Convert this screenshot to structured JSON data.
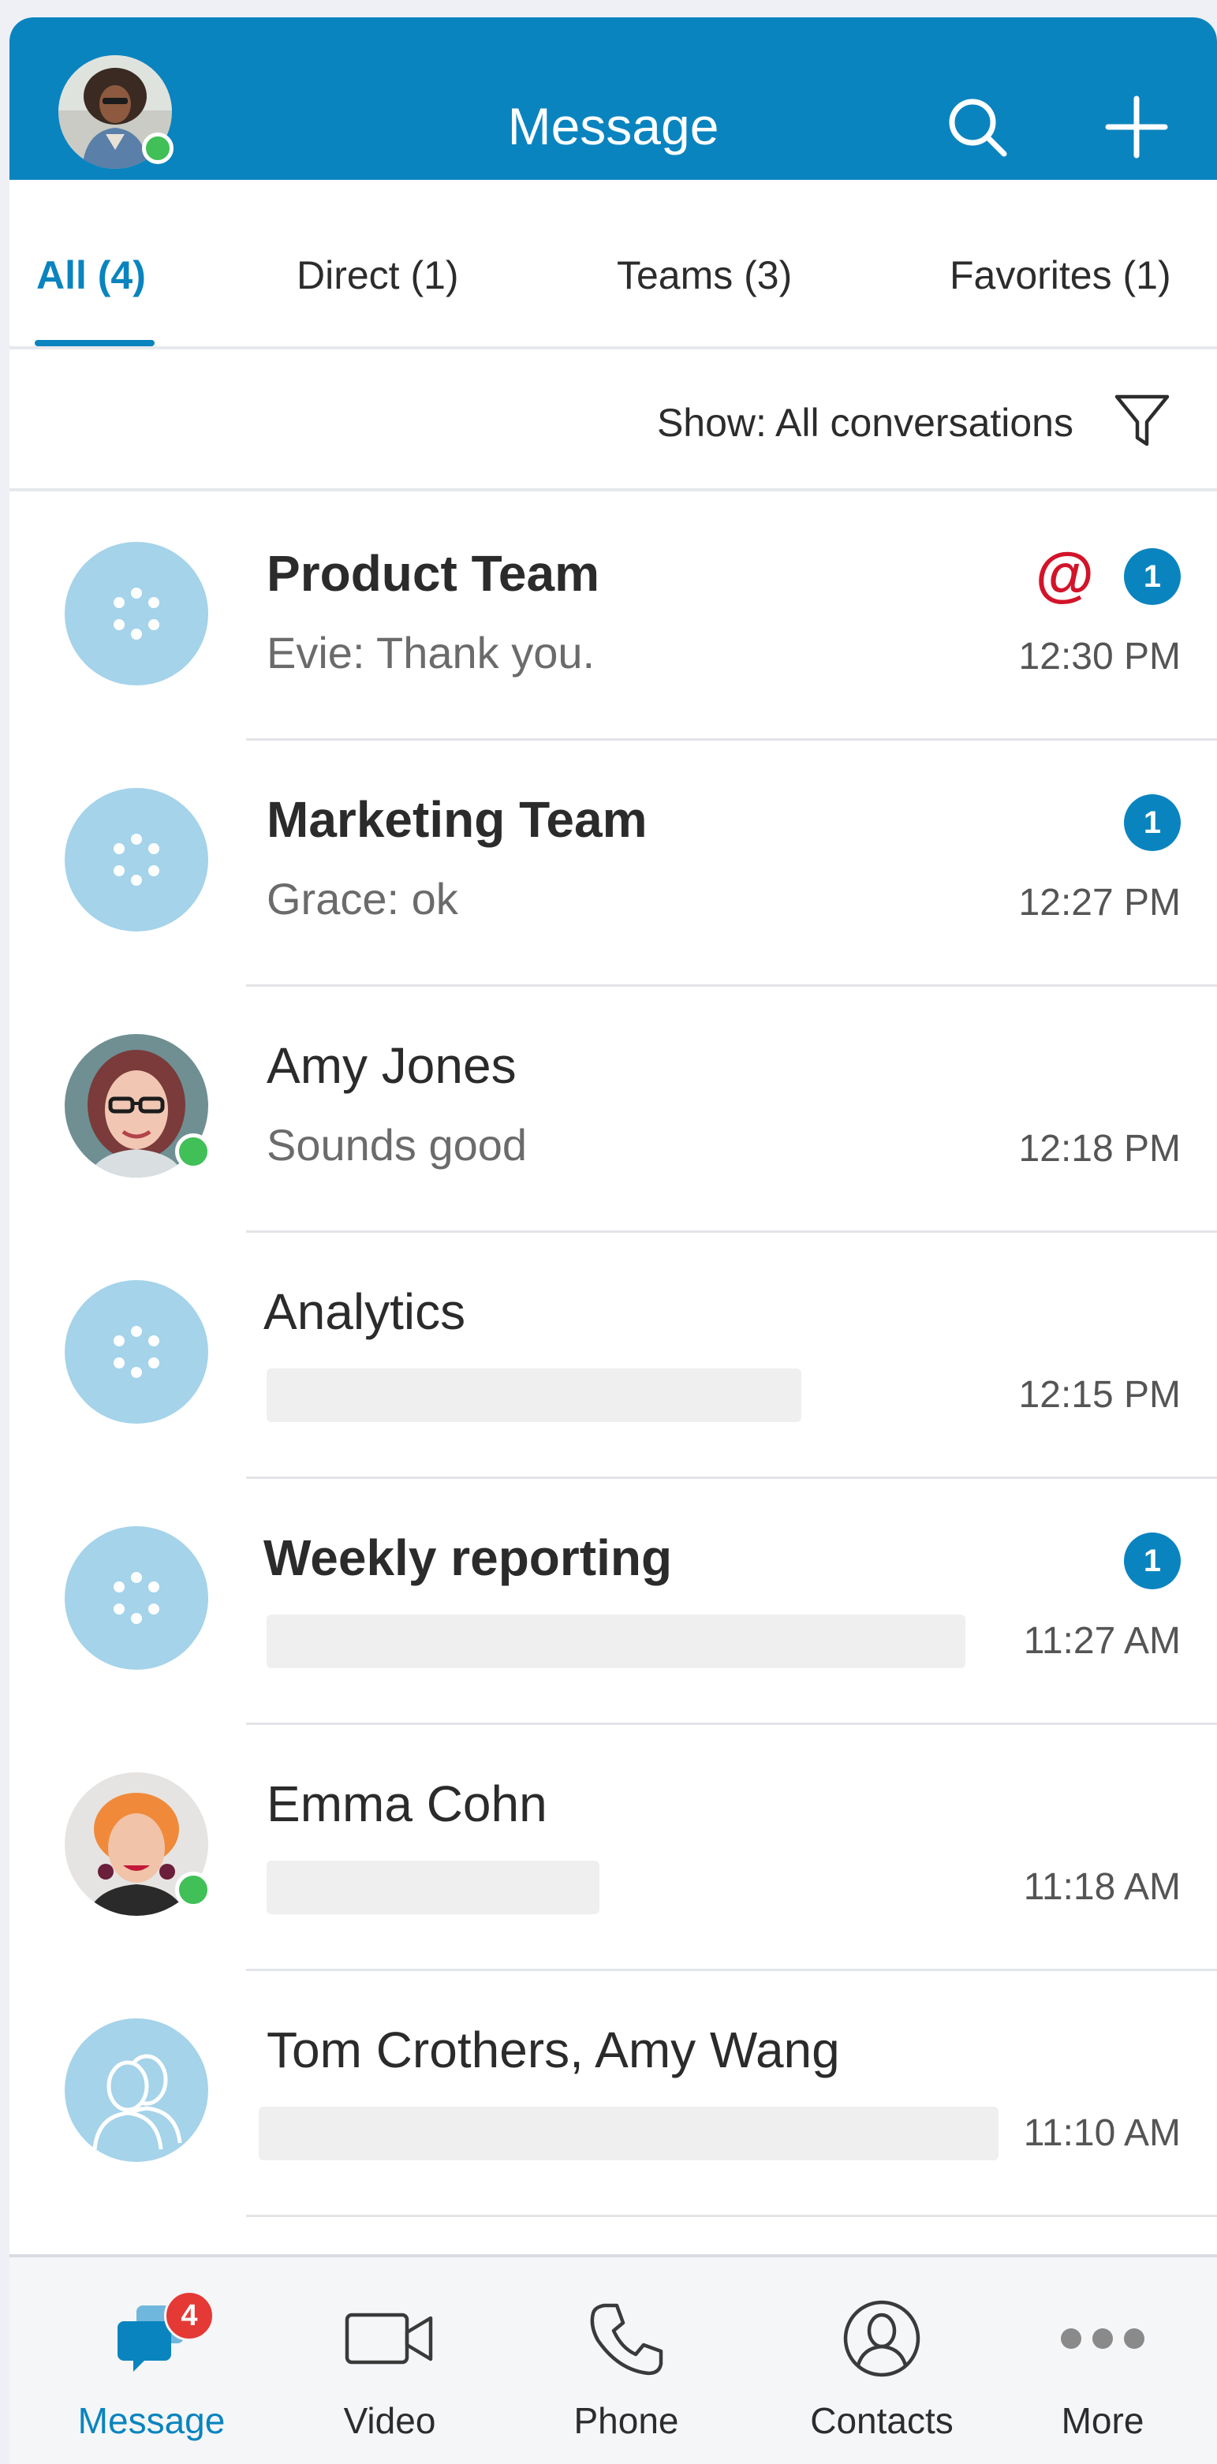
{
  "header": {
    "title": "Message",
    "accent": "#0a84bf"
  },
  "tabs": [
    {
      "label": "All (4)",
      "active": true
    },
    {
      "label": "Direct (1)",
      "active": false
    },
    {
      "label": "Teams (3)",
      "active": false
    },
    {
      "label": "Favorites (1)",
      "active": false
    }
  ],
  "filter": {
    "label": "Show: All conversations",
    "icon": "filter-icon"
  },
  "conversations": [
    {
      "name": "Product Team",
      "preview": "Evie: Thank you.",
      "time": "12:30 PM",
      "bold": true,
      "avatar": "team",
      "mention": "@",
      "badge": "1"
    },
    {
      "name": "Marketing Team",
      "preview": "Grace: ok",
      "time": "12:27 PM",
      "bold": true,
      "avatar": "team",
      "badge": "1"
    },
    {
      "name": "Amy Jones",
      "preview": "Sounds good",
      "time": "12:18 PM",
      "bold": false,
      "avatar": "person-amy",
      "online": true
    },
    {
      "name": "Analytics",
      "preview": "",
      "time": "12:15 PM",
      "bold": false,
      "avatar": "team"
    },
    {
      "name": "Weekly reporting",
      "preview": "",
      "time": "11:27 AM",
      "bold": true,
      "avatar": "team",
      "badge": "1"
    },
    {
      "name": "Emma Cohn",
      "preview": "",
      "time": "11:18 AM",
      "bold": false,
      "avatar": "person-emma",
      "online": true
    },
    {
      "name": "Tom Crothers, Amy Wang",
      "preview": "",
      "time": "11:10 AM",
      "bold": false,
      "avatar": "group"
    }
  ],
  "bottom_nav": [
    {
      "label": "Message",
      "icon": "message-icon",
      "active": true,
      "badge": "4"
    },
    {
      "label": "Video",
      "icon": "video-icon",
      "active": false
    },
    {
      "label": "Phone",
      "icon": "phone-icon",
      "active": false
    },
    {
      "label": "Contacts",
      "icon": "contacts-icon",
      "active": false
    },
    {
      "label": "More",
      "icon": "more-icon",
      "active": false
    }
  ],
  "colors": {
    "team_avatar": "#a4d3ea",
    "presence": "#40c057",
    "mention": "#d2142a",
    "nav_badge": "#e53935"
  }
}
